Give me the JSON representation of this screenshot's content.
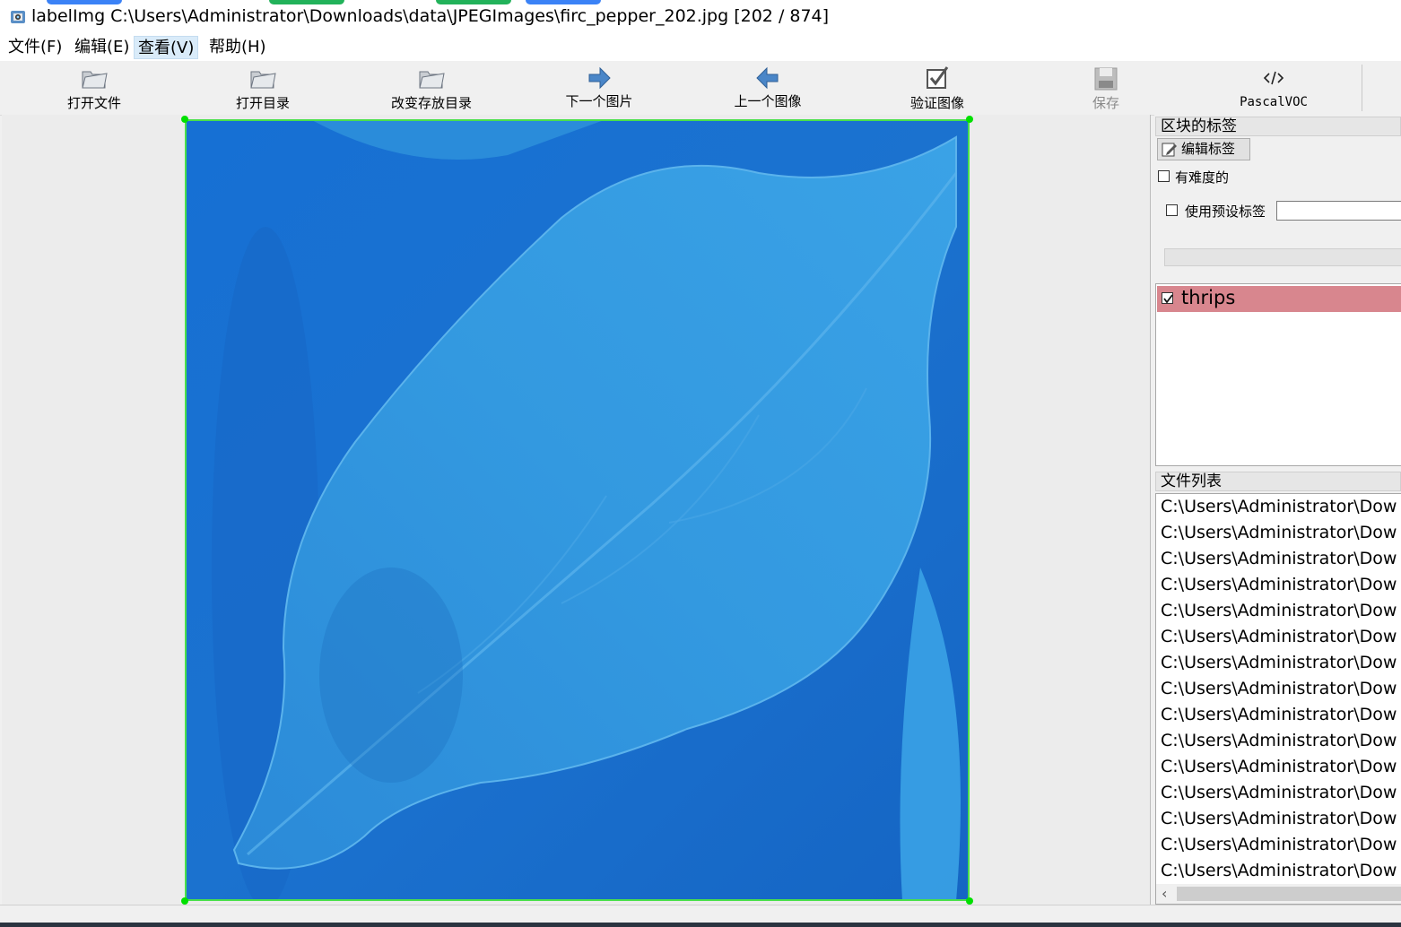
{
  "window": {
    "title": "labelImg C:\\Users\\Administrator\\Downloads\\data\\JPEGImages\\firc_pepper_202.jpg [202 / 874]"
  },
  "menu": [
    "文件(F)",
    "编辑(E)",
    "查看(V)",
    "帮助(H)"
  ],
  "menu_active_index": 2,
  "toolbar": {
    "open_file": "打开文件",
    "open_dir": "打开目录",
    "change_save_dir": "改变存放目录",
    "next_image": "下一个图片",
    "prev_image": "上一个图像",
    "verify_image": "验证图像",
    "save": "保存",
    "format": "PascalVOC"
  },
  "dock": {
    "box_labels_title": "区块的标签",
    "edit_label_button": "编辑标签",
    "difficult_label": "有难度的",
    "use_default_label": "使用预设标签",
    "default_label_value": "",
    "labels": [
      {
        "name": "thrips",
        "checked": true
      }
    ],
    "file_list_title": "文件列表",
    "files": [
      "C:\\Users\\Administrator\\Dow",
      "C:\\Users\\Administrator\\Dow",
      "C:\\Users\\Administrator\\Dow",
      "C:\\Users\\Administrator\\Dow",
      "C:\\Users\\Administrator\\Dow",
      "C:\\Users\\Administrator\\Dow",
      "C:\\Users\\Administrator\\Dow",
      "C:\\Users\\Administrator\\Dow",
      "C:\\Users\\Administrator\\Dow",
      "C:\\Users\\Administrator\\Dow",
      "C:\\Users\\Administrator\\Dow",
      "C:\\Users\\Administrator\\Dow",
      "C:\\Users\\Administrator\\Dow",
      "C:\\Users\\Administrator\\Dow",
      "C:\\Users\\Administrator\\Dow"
    ]
  },
  "colors": {
    "bbox": "#4ae04a",
    "label_highlight": "#d8868e",
    "image_tint": "#1a6fd0"
  }
}
